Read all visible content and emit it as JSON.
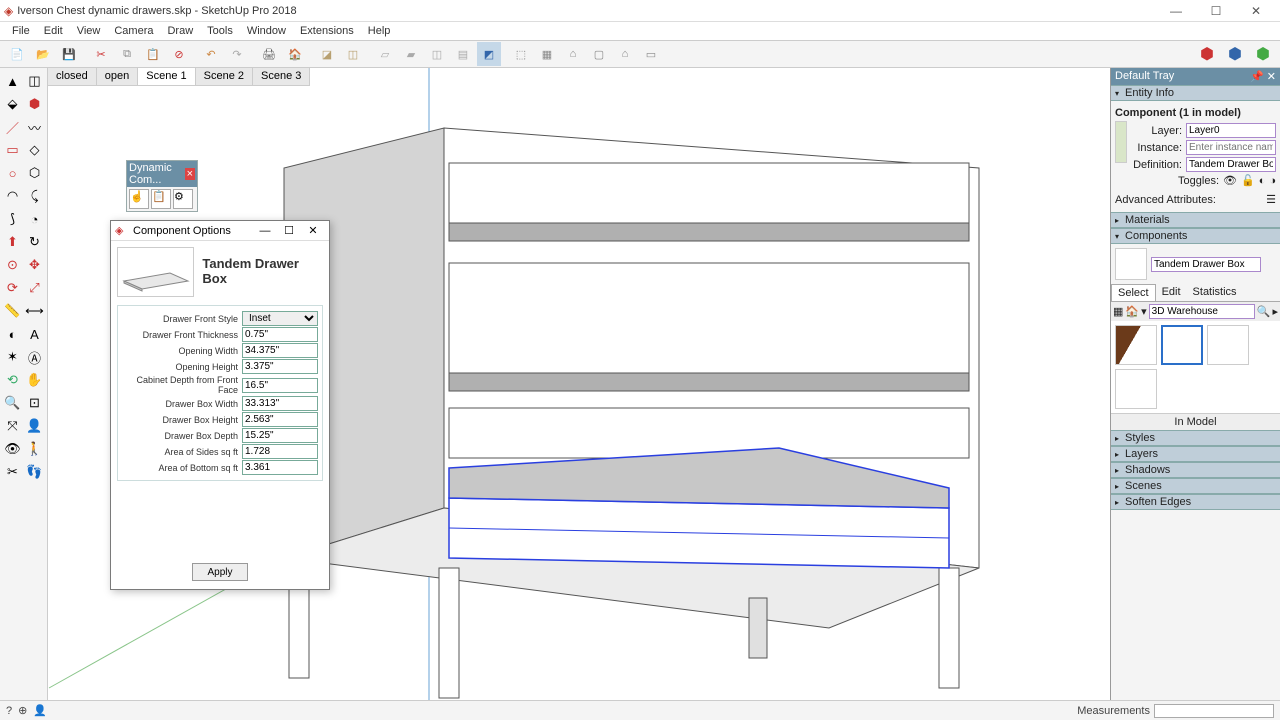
{
  "app": {
    "title": "Iverson Chest dynamic drawers.skp - SketchUp Pro 2018"
  },
  "menu": [
    "File",
    "Edit",
    "View",
    "Camera",
    "Draw",
    "Tools",
    "Window",
    "Extensions",
    "Help"
  ],
  "scene_tabs": [
    "closed",
    "open",
    "Scene 1",
    "Scene 2",
    "Scene 3"
  ],
  "active_scene": "Scene 1",
  "dc_palette": {
    "title": "Dynamic Com..."
  },
  "dialog": {
    "title": "Component Options",
    "component_name": "Tandem Drawer Box",
    "apply": "Apply",
    "fields": [
      {
        "label": "Drawer Front Style",
        "value": "Inset",
        "type": "select"
      },
      {
        "label": "Drawer Front Thickness",
        "value": "0.75\""
      },
      {
        "label": "Opening Width",
        "value": "34.375\""
      },
      {
        "label": "Opening Height",
        "value": "3.375\""
      },
      {
        "label": "Cabinet Depth from Front Face",
        "value": "16.5\""
      },
      {
        "label": "Drawer Box Width",
        "value": "33.313\""
      },
      {
        "label": "Drawer Box Height",
        "value": "2.563\""
      },
      {
        "label": "Drawer Box Depth",
        "value": "15.25\""
      },
      {
        "label": "Area of Sides sq ft",
        "value": "1.728"
      },
      {
        "label": "Area of Bottom sq ft",
        "value": "3.361"
      }
    ]
  },
  "tray": {
    "title": "Default Tray",
    "entity_info": {
      "title": "Entity Info",
      "header": "Component (1 in model)",
      "layer_label": "Layer:",
      "layer": "Layer0",
      "instance_label": "Instance:",
      "instance_placeholder": "Enter instance name",
      "definition_label": "Definition:",
      "definition": "Tandem Drawer Box",
      "toggles_label": "Toggles:",
      "adv": "Advanced Attributes:"
    },
    "materials": "Materials",
    "components": {
      "title": "Components",
      "name": "Tandem Drawer Box",
      "tabs": [
        "Select",
        "Edit",
        "Statistics"
      ],
      "warehouse": "3D Warehouse",
      "in_model": "In Model"
    },
    "styles": "Styles",
    "layers": "Layers",
    "shadows": "Shadows",
    "scenes": "Scenes",
    "soften": "Soften Edges"
  },
  "status": {
    "measurements_label": "Measurements"
  }
}
